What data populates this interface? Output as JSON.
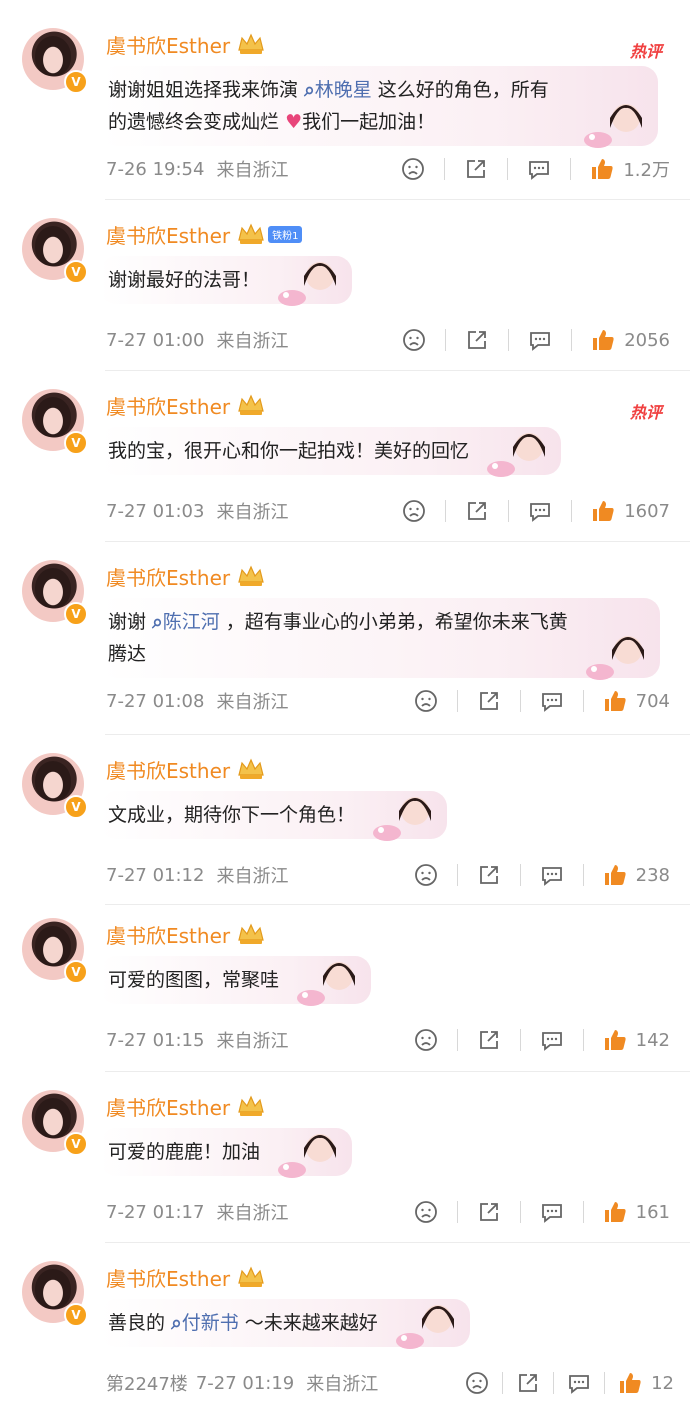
{
  "author": {
    "name": "虞书欣Esther",
    "verified_badge": "V",
    "fan_badge": "铁粉1"
  },
  "hot_label": "热评",
  "comments": [
    {
      "time": "7-26 19:54",
      "location": "来自浙江",
      "likes": "1.2万",
      "hot": true,
      "text_parts": [
        "谢谢姐姐选择我来饰演",
        "林晚星",
        "这么好的角色，所有的遗憾终会变成灿烂",
        "我们一起加油！"
      ]
    },
    {
      "time": "7-27 01:00",
      "location": "来自浙江",
      "likes": "2056",
      "hot": false,
      "fan_badge": true,
      "text": "谢谢最好的法哥！"
    },
    {
      "time": "7-27 01:03",
      "location": "来自浙江",
      "likes": "1607",
      "hot": true,
      "text": "我的宝，很开心和你一起拍戏！美好的回忆"
    },
    {
      "time": "7-27 01:08",
      "location": "来自浙江",
      "likes": "704",
      "hot": false,
      "text_parts": [
        "谢谢",
        "陈江河",
        "，超有事业心的小弟弟，希望你未来飞黄腾达"
      ]
    },
    {
      "time": "7-27 01:12",
      "location": "来自浙江",
      "likes": "238",
      "hot": false,
      "text": "文成业，期待你下一个角色！"
    },
    {
      "time": "7-27 01:15",
      "location": "来自浙江",
      "likes": "142",
      "hot": false,
      "text": "可爱的图图，常聚哇"
    },
    {
      "time": "7-27 01:17",
      "location": "来自浙江",
      "likes": "161",
      "hot": false,
      "text": "可爱的鹿鹿！加油"
    },
    {
      "floor": "第2247楼",
      "time": "7-27 01:19",
      "location": "来自浙江",
      "likes": "12",
      "hot": false,
      "text_parts": [
        "善良的",
        "付新书",
        "～未来越来越好"
      ]
    }
  ],
  "colors": {
    "username": "#f08a22",
    "topic": "#4f6fb0",
    "like": "#f08a22",
    "hot": "#f04040"
  }
}
